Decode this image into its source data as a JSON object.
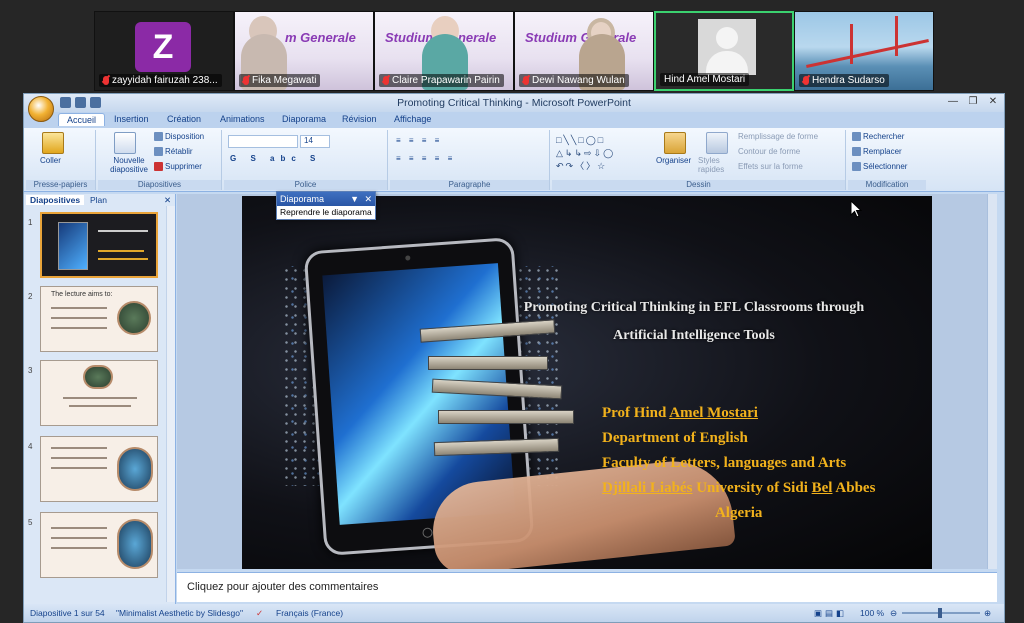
{
  "participants": [
    {
      "name": "zayyidah fairuzah 238...",
      "initial": "Z"
    },
    {
      "name": "Fika Megawati"
    },
    {
      "name": "Claire Prapawarin Pairin"
    },
    {
      "name": "Dewi Nawang Wulan"
    },
    {
      "name": "Hind Amel Mostari"
    },
    {
      "name": "Hendra Sudarso"
    }
  ],
  "banner_text": [
    "m Generale",
    "Studium Generale",
    "Studium Generale"
  ],
  "window": {
    "title": "Promoting Critical Thinking - Microsoft PowerPoint"
  },
  "ribbon_tabs": [
    "Accueil",
    "Insertion",
    "Création",
    "Animations",
    "Diaporama",
    "Révision",
    "Affichage"
  ],
  "ribbon": {
    "groups": [
      "Presse-papiers",
      "Diapositives",
      "Police",
      "Paragraphe",
      "Dessin",
      "Modification"
    ],
    "coller": "Coller",
    "nouvelle": "Nouvelle diapositive",
    "disposition": "Disposition",
    "retablir": "Rétablir",
    "supprimer": "Supprimer",
    "font_size": "14",
    "organiser": "Organiser",
    "styles": "Styles rapides",
    "remplissage": "Remplissage de forme",
    "contour": "Contour de forme",
    "effets": "Effets sur la forme",
    "rechercher": "Rechercher",
    "remplacer": "Remplacer",
    "selectionner": "Sélectionner"
  },
  "popup": {
    "title": "Diaporama",
    "action": "Reprendre le diaporama"
  },
  "left_panel": {
    "tabs": [
      "Diapositives",
      "Plan"
    ],
    "thumbs": [
      {
        "num": "1",
        "text": ""
      },
      {
        "num": "2",
        "text": "The lecture aims to:"
      },
      {
        "num": "3",
        "text": ""
      },
      {
        "num": "4",
        "text": ""
      },
      {
        "num": "5",
        "text": ""
      }
    ]
  },
  "slide": {
    "title_line1": "Promoting Critical Thinking in EFL Classrooms through",
    "title_line2": "Artificial Intelligence Tools",
    "author_line1_pre": "Prof Hind ",
    "author_line1_u": "Amel Mostari",
    "department": "Department of English",
    "faculty": "Faculty of Letters, languages and Arts",
    "university_u1": "Djillali Liabés",
    "university_mid": " University of Sidi ",
    "university_u2": "Bel",
    "university_end": " Abbes",
    "country": "Algeria"
  },
  "notes_placeholder": "Cliquez pour ajouter des commentaires",
  "status": {
    "slide_count": "Diapositive 1 sur 54",
    "theme": "\"Minimalist Aesthetic by Slidesgo\"",
    "language": "Français (France)",
    "zoom": "100 %"
  }
}
